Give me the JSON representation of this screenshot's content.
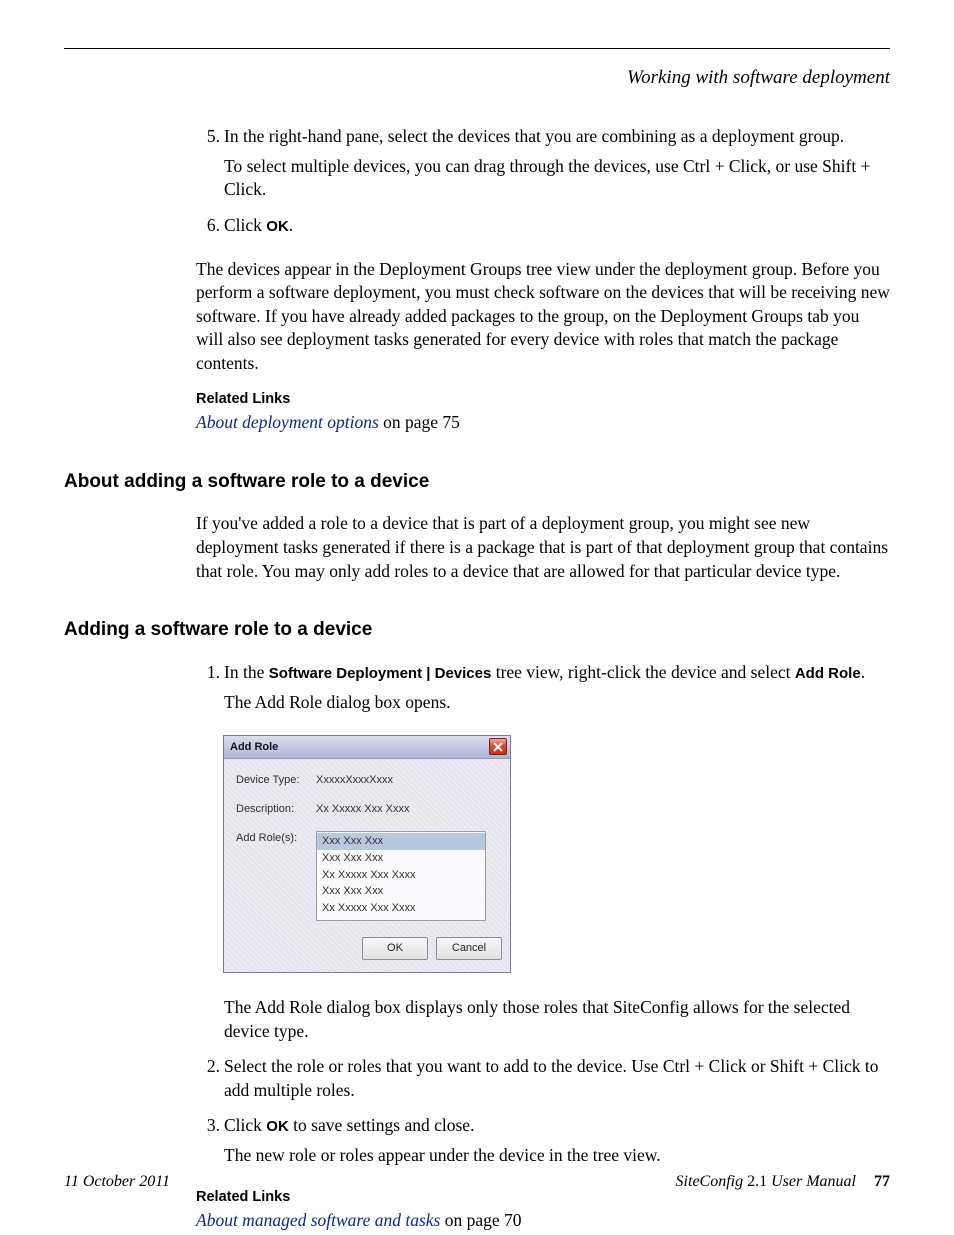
{
  "runningHead": "Working with software deployment",
  "section1": {
    "steps": [
      {
        "num": "5.",
        "lines": [
          "In the right-hand pane, select the devices that you are combining as a deployment group.",
          "To select multiple devices, you can drag through the devices, use Ctrl + Click, or use Shift + Click."
        ]
      },
      {
        "num": "6.",
        "prefix": "Click ",
        "bold": "OK",
        "suffix": "."
      }
    ],
    "paraAfter": "The devices appear in the Deployment Groups tree view under the deployment group. Before you perform a software deployment, you must check software on the devices that will be receiving new software. If you have already added packages to the group, on the Deployment Groups tab you will also see deployment tasks generated for every device with roles that match the package contents.",
    "relatedLinksHeading": "Related Links",
    "relatedLinkText": "About deployment options",
    "relatedLinkSuffix": " on page 75"
  },
  "section2": {
    "heading": "About adding a software role to a device",
    "para": "If you've added a role to a device that is part of a deployment group, you might see new deployment tasks generated if there is a package that is part of that deployment group that contains that role. You may only add roles to a device that are allowed for that particular device type."
  },
  "section3": {
    "heading": "Adding a software role to a device",
    "step1": {
      "num": "1.",
      "parts": {
        "a": "In the ",
        "b": "Software Deployment | Devices",
        "c": " tree view, right-click the device and select ",
        "d": "Add Role",
        "e": "."
      },
      "after": "The Add Role dialog box opens."
    },
    "dialog": {
      "title": "Add Role",
      "deviceTypeLabel": "Device Type:",
      "deviceTypeValue": "XxxxxXxxxXxxx",
      "descriptionLabel": "Description:",
      "descriptionValue": "Xx Xxxxx Xxx Xxxx",
      "addRolesLabel": "Add Role(s):",
      "roles": [
        "Xxx Xxx Xxx",
        "Xxx Xxx Xxx",
        "Xx Xxxxx Xxx Xxxx",
        "Xxx Xxx Xxx",
        "Xx Xxxxx Xxx Xxxx"
      ],
      "ok": "OK",
      "cancel": "Cancel"
    },
    "afterDialog": "The Add Role dialog box displays only those roles that SiteConfig allows for the selected device type.",
    "step2": {
      "num": "2.",
      "text": "Select the role or roles that you want to add to the device. Use Ctrl + Click or Shift + Click to add multiple roles."
    },
    "step3": {
      "num": "3.",
      "prefix": "Click ",
      "bold": "OK",
      "suffix": " to save settings and close.",
      "after": "The new role or roles appear under the device in the tree view."
    },
    "relatedLinksHeading": "Related Links",
    "relatedLinkText": "About managed software and tasks",
    "relatedLinkSuffix": " on page 70"
  },
  "footer": {
    "date": "11 October 2011",
    "productItalic": "SiteConfig",
    "productRest": " 2.1 ",
    "manual": "User Manual",
    "page": "77"
  }
}
